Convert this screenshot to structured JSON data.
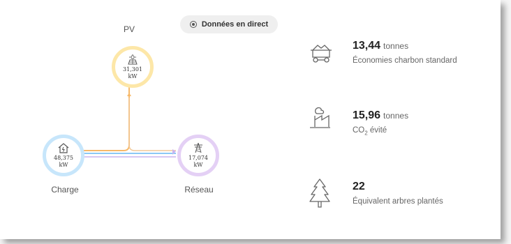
{
  "live_toggle": {
    "label": "Données en direct"
  },
  "nodes": {
    "pv": {
      "label": "PV",
      "value": "31,301",
      "unit": "kW"
    },
    "load": {
      "label": "Charge",
      "value": "48,375",
      "unit": "kW"
    },
    "grid": {
      "label": "Réseau",
      "value": "17,074",
      "unit": "kW"
    }
  },
  "stats": [
    {
      "value": "13,44",
      "unit": "tonnes",
      "label": "Économies charbon standard",
      "icon": "coal-cart-icon"
    },
    {
      "value": "15,96",
      "unit": "tonnes",
      "label_prefix": "CO",
      "label_sub": "2",
      "label_suffix": " évité",
      "icon": "factory-icon"
    },
    {
      "value": "22",
      "unit": "",
      "label": "Équivalent arbres plantés",
      "icon": "tree-icon"
    }
  ],
  "colors": {
    "pv_ring": "#fde7a8",
    "load_ring": "#c7e6fb",
    "grid_ring": "#e4d0f5",
    "pv_flow": "#f7b96a",
    "load_flow": "#8cc8f5",
    "grid_flow": "#c9b4ef"
  }
}
